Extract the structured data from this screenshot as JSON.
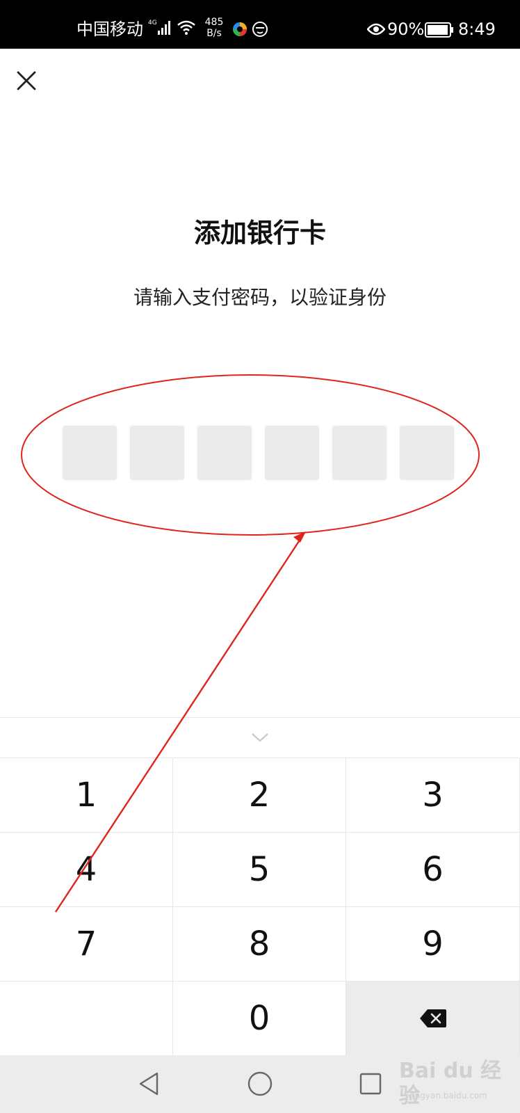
{
  "status_bar": {
    "carrier": "中国移动",
    "network": "4G",
    "speed_value": "485",
    "speed_unit": "B/s",
    "battery_pct": "90%",
    "time": "8:49"
  },
  "title": "添加银行卡",
  "subtitle": "请输入支付密码，以验证身份",
  "pin_length": 6,
  "keypad": {
    "keys": [
      "1",
      "2",
      "3",
      "4",
      "5",
      "6",
      "7",
      "8",
      "9",
      "",
      "0",
      "backspace"
    ]
  },
  "icons": {
    "close": "close-icon",
    "collapse": "chevron-down-icon",
    "backspace": "backspace-icon",
    "nav_back": "triangle-back-icon",
    "nav_home": "circle-home-icon",
    "nav_recent": "square-recent-icon"
  },
  "colors": {
    "annotation": "#e0241b",
    "pin_box": "#ebebeb",
    "status_bar": "#000000"
  },
  "watermark": {
    "text": "Bai du 经验",
    "sub": "jingyan.baidu.com"
  }
}
